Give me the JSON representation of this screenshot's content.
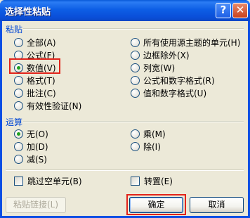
{
  "window": {
    "title": "选择性粘贴",
    "help": "?",
    "close": "✕"
  },
  "paste": {
    "label": "粘贴",
    "left": [
      "全部(A)",
      "公式(F)",
      "数值(V)",
      "格式(T)",
      "批注(C)",
      "有效性验证(N)"
    ],
    "right": [
      "所有使用源主题的单元(H)",
      "边框除外(X)",
      "列宽(W)",
      "公式和数字格式(R)",
      "值和数字格式(U)"
    ],
    "selected": "数值(V)"
  },
  "operation": {
    "label": "运算",
    "left": [
      "无(O)",
      "加(D)",
      "减(S)"
    ],
    "right": [
      "乘(M)",
      "除(I)"
    ],
    "selected": "无(O)"
  },
  "checks": {
    "skip_blanks": "跳过空单元(B)",
    "transpose": "转置(E)"
  },
  "buttons": {
    "paste_link": "粘贴链接(L)",
    "ok": "确定",
    "cancel": "取消"
  },
  "colors": {
    "titlebar": "#0a4ee4",
    "section_label": "#0046d5",
    "highlight": "#e2231a",
    "radio_dot": "#21a121"
  }
}
